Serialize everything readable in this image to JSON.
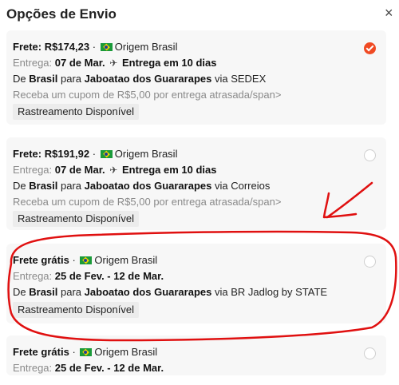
{
  "header": {
    "title": "Opções de Envio",
    "close_symbol": "×"
  },
  "options": [
    {
      "price_label": "Frete: R$174,23",
      "separator": "·",
      "origin": "Origem Brasil",
      "delivery_label": "Entrega:",
      "delivery_date": "07 de Mar.",
      "delivery_days": "Entrega em 10 dias",
      "route_de": "De",
      "route_from": "Brasil",
      "route_para": "para",
      "route_to": "Jaboatao dos Guararapes",
      "route_via": "via SEDEX",
      "coupon": "Receba um cupom de R$5,00 por entrega atrasada/span>",
      "tracking": "Rastreamento Disponível",
      "selected": true
    },
    {
      "price_label": "Frete: R$191,92",
      "separator": "·",
      "origin": "Origem Brasil",
      "delivery_label": "Entrega:",
      "delivery_date": "07 de Mar.",
      "delivery_days": "Entrega em 10 dias",
      "route_de": "De",
      "route_from": "Brasil",
      "route_para": "para",
      "route_to": "Jaboatao dos Guararapes",
      "route_via": "via Correios",
      "coupon": "Receba um cupom de R$5,00 por entrega atrasada/span>",
      "tracking": "Rastreamento Disponível",
      "selected": false
    },
    {
      "price_label": "Frete grátis",
      "separator": "·",
      "origin": "Origem Brasil",
      "delivery_label": "Entrega:",
      "delivery_date": "25 de Fev. - 12 de Mar.",
      "route_de": "De",
      "route_from": "Brasil",
      "route_para": "para",
      "route_to": "Jaboatao dos Guararapes",
      "route_via": "via BR Jadlog by STATE",
      "tracking": "Rastreamento Disponível",
      "selected": false
    },
    {
      "price_label": "Frete grátis",
      "separator": "·",
      "origin": "Origem Brasil",
      "delivery_label": "Entrega:",
      "delivery_date": "25 de Fev. - 12 de Mar.",
      "selected": false
    }
  ],
  "colors": {
    "accent": "#f04a23",
    "annotation": "#e01010"
  },
  "icons": [
    "close-icon",
    "brazil-flag-icon",
    "airplane-icon",
    "radio-checked-icon",
    "radio-unchecked-icon"
  ]
}
